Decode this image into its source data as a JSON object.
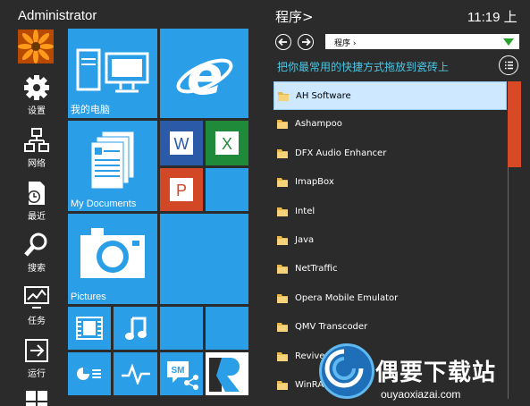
{
  "header": {
    "username": "Administrator"
  },
  "sidebar": {
    "items": [
      {
        "label": "设置",
        "icon": "gear-icon"
      },
      {
        "label": "网络",
        "icon": "network-icon"
      },
      {
        "label": "最近",
        "icon": "recent-icon"
      },
      {
        "label": "搜索",
        "icon": "search-icon"
      },
      {
        "label": "任务",
        "icon": "task-icon"
      },
      {
        "label": "运行",
        "icon": "run-icon"
      }
    ]
  },
  "tiles": {
    "my_computer": "我的电脑",
    "my_documents": "My Documents",
    "pictures": "Pictures"
  },
  "programs": {
    "title": "程序>",
    "clock": "11:19 上",
    "location": "程序 ›",
    "hint": "把你最常用的快捷方式拖放到瓷砖上",
    "items": [
      {
        "name": "AH Software",
        "selected": true
      },
      {
        "name": "Ashampoo"
      },
      {
        "name": "DFX Audio Enhancer"
      },
      {
        "name": "ImapBox"
      },
      {
        "name": "Intel"
      },
      {
        "name": "Java"
      },
      {
        "name": "NetTraffic"
      },
      {
        "name": "Opera Mobile Emulator"
      },
      {
        "name": "QMV Transcoder"
      },
      {
        "name": "Revive"
      },
      {
        "name": "WinRAR"
      }
    ]
  },
  "watermark": {
    "text": "偶要下载站",
    "url": "ouyaoxiazai.com"
  },
  "colors": {
    "tile": "#2a9ee6",
    "word": "#2a5aa8",
    "excel": "#1f8a3a",
    "ppt": "#d24726",
    "scroll": "#d84a26",
    "accent": "#49c7e6"
  }
}
